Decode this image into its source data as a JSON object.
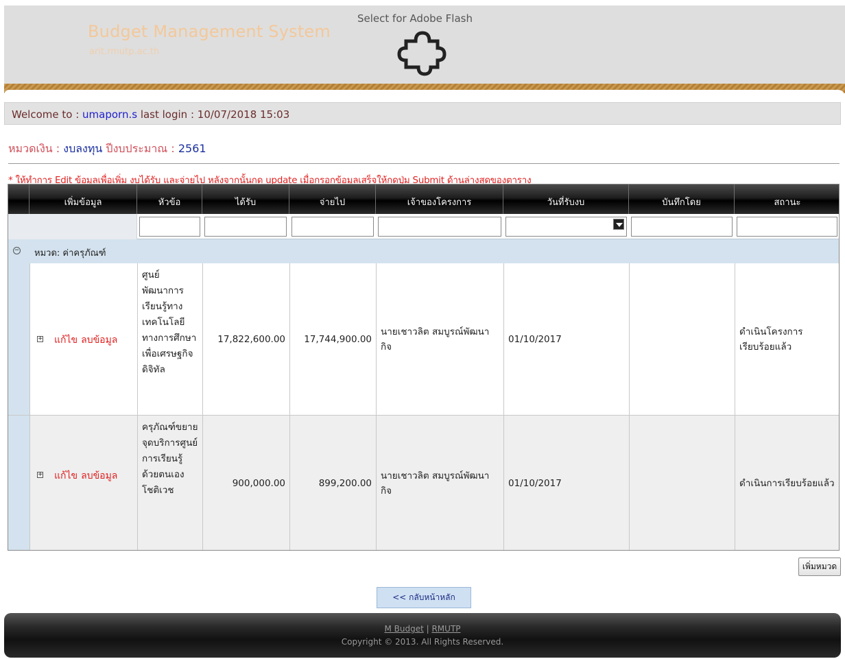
{
  "header": {
    "brand_title": "Budget Management System",
    "brand_sub": "arit.rmutp.ac.th",
    "flash_prompt": "Select for Adobe Flash"
  },
  "welcome": {
    "prefix": "Welcome to : ",
    "username": "umaporn.s",
    "last_login_label": " last login : ",
    "last_login": "10/07/2018 15:03"
  },
  "section": {
    "category_label": "หมวดเงิน : ",
    "category_value": "งบลงทุน",
    "year_label": " ปีงบประมาณ : ",
    "year_value": "2561"
  },
  "notice": "* ให้ทำการ Edit ข้อมูลเพื่อเพิ่ม งบได้รับ และจ่ายไป หลังจากนั้นกด update เมื่อกรอกข้อมูลเสร็จให้กดปุ่ม Submit ด้านล่างสุดของตาราง",
  "grid": {
    "columns": [
      "เพิ่มข้อมูล",
      "หัวข้อ",
      "ได้รับ",
      "จ่ายไป",
      "เจ้าของโครงการ",
      "วันที่รับงบ",
      "บันทึกโดย",
      "สถานะ"
    ],
    "group_label": "หมวด: ค่าครุภัณฑ์",
    "rows": [
      {
        "edit": "แก้ไข",
        "delete": "ลบข้อมูล",
        "topic": "ศูนย์พัฒนาการเรียนรู้ทางเทคโนโลยีทางการศึกษาเพื่อเศรษฐกิจดิจิทัล",
        "received": "17,822,600.00",
        "spent": "17,744,900.00",
        "owner": "นายเชาวลิต สมบูรณ์พัฒนากิจ",
        "date": "01/10/2017",
        "recorded_by": "",
        "status": "ดำเนินโครงการเรียบร้อยแล้ว"
      },
      {
        "edit": "แก้ไข",
        "delete": "ลบข้อมูล",
        "topic": "ครุภัณฑ์ขยายจุดบริการศูนย์การเรียนรู้ด้วยตนเองโชติเวช",
        "received": "900,000.00",
        "spent": "899,200.00",
        "owner": "นายเชาวลิต สมบูรณ์พัฒนากิจ",
        "date": "01/10/2017",
        "recorded_by": "",
        "status": "ดำเนินการเรียบร้อยแล้ว"
      }
    ]
  },
  "buttons": {
    "add_category": "เพิ่มหมวด",
    "back_home": "<< กลับหน้าหลัก"
  },
  "footer": {
    "link1": "M Budget",
    "separator": " | ",
    "link2": "RMUTP",
    "copyright": "Copyright © 2013. All Rights Reserved."
  },
  "colors": {
    "accent_red": "#e02020",
    "user_blue": "#2020d0",
    "group_bg": "#d3e2ee"
  }
}
